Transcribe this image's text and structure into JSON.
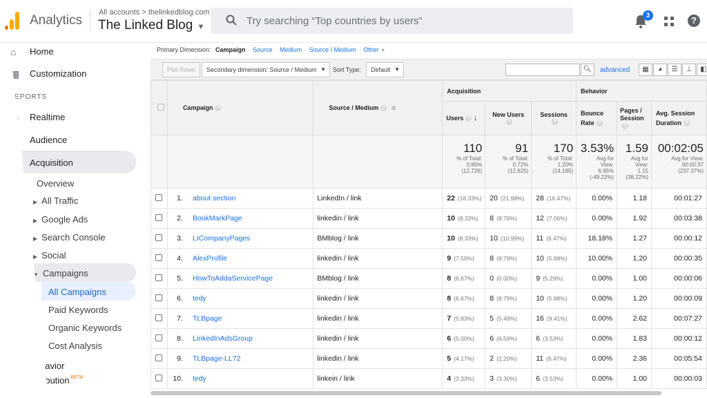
{
  "header": {
    "brand": "Analytics",
    "account_path": "All accounts > thelinkedblog.com",
    "account_name": "The Linked Blog",
    "search_placeholder": "Try searching “Top countries by users”",
    "notification_count": "3"
  },
  "sidebar": {
    "home": "Home",
    "customization": "Customization",
    "reports_heading": "REPORTS",
    "realtime": "Realtime",
    "audience": "Audience",
    "acquisition": "Acquisition",
    "overview": "Overview",
    "all_traffic": "All Traffic",
    "google_ads": "Google Ads",
    "search_console": "Search Console",
    "social": "Social",
    "campaigns": "Campaigns",
    "all_campaigns": "All Campaigns",
    "paid_keywords": "Paid Keywords",
    "organic_keywords": "Organic Keywords",
    "cost_analysis": "Cost Analysis",
    "behavior": "havior",
    "attribution": "ribution",
    "beta": "BETA"
  },
  "primary_dimension": {
    "label": "Primary Dimension:",
    "selected": "Campaign",
    "options": [
      "Source",
      "Medium",
      "Source / Medium",
      "Other"
    ]
  },
  "toolbar": {
    "plot_rows": "Plot Rows",
    "secondary_dimension": "Secondary dimension: Source / Medium",
    "sort_type_label": "Sort Type:",
    "sort_type_value": "Default",
    "advanced": "advanced"
  },
  "table": {
    "group_acquisition": "Acquisition",
    "group_behavior": "Behavior",
    "col_campaign": "Campaign",
    "col_source_medium": "Source / Medium",
    "col_users": "Users",
    "col_new_users": "New Users",
    "col_sessions": "Sessions",
    "col_bounce_rate": "Bounce Rate",
    "col_pages_session": "Pages / Session",
    "col_avg_duration": "Avg. Session Duration",
    "totals": {
      "users": {
        "value": "110",
        "l1": "% of Total:",
        "l2": "0.86%",
        "l3": "(12,726)"
      },
      "new_users": {
        "value": "91",
        "l1": "% of Total:",
        "l2": "0.72%",
        "l3": "(12,625)"
      },
      "sessions": {
        "value": "170",
        "l1": "% of Total:",
        "l2": "1.20%",
        "l3": "(14,185)"
      },
      "bounce": {
        "value": "3.53%",
        "l1": "Avg for",
        "l2": "View:",
        "l3": "6.95%",
        "l4": "(-49.22%)"
      },
      "pages": {
        "value": "1.59",
        "l1": "Avg for",
        "l2": "View:",
        "l3": "1.15",
        "l4": "(38.22%)"
      },
      "duration": {
        "value": "00:02:05",
        "l1": "Avg for View:",
        "l2": "00:00:37",
        "l3": "(237.37%)"
      }
    },
    "rows": [
      {
        "n": "1.",
        "campaign": "about section",
        "sm": "LinkedIn / link",
        "users": "22",
        "users_pct": "(18.33%)",
        "new": "20",
        "new_pct": "(21.98%)",
        "sess": "28",
        "sess_pct": "(16.47%)",
        "bounce": "0.00%",
        "pages": "1.18",
        "dur": "00:01:27"
      },
      {
        "n": "2.",
        "campaign": "BookMarkPage",
        "sm": "linkedin / link",
        "users": "10",
        "users_pct": "(8.33%)",
        "new": "8",
        "new_pct": "(8.79%)",
        "sess": "12",
        "sess_pct": "(7.06%)",
        "bounce": "0.00%",
        "pages": "1.92",
        "dur": "00:03:38"
      },
      {
        "n": "3.",
        "campaign": "LICompanyPages",
        "sm": "BMblog / link",
        "users": "10",
        "users_pct": "(8.33%)",
        "new": "10",
        "new_pct": "(10.99%)",
        "sess": "11",
        "sess_pct": "(6.47%)",
        "bounce": "18.18%",
        "pages": "1.27",
        "dur": "00:00:12"
      },
      {
        "n": "4.",
        "campaign": "AlexProfile",
        "sm": "linkedin / link",
        "users": "9",
        "users_pct": "(7.50%)",
        "new": "8",
        "new_pct": "(8.79%)",
        "sess": "10",
        "sess_pct": "(5.88%)",
        "bounce": "10.00%",
        "pages": "1.20",
        "dur": "00:00:35"
      },
      {
        "n": "5.",
        "campaign": "HowToAddaServicePage",
        "sm": "BMblog / link",
        "users": "8",
        "users_pct": "(6.67%)",
        "new": "0",
        "new_pct": "(0.00%)",
        "sess": "9",
        "sess_pct": "(5.29%)",
        "bounce": "0.00%",
        "pages": "1.00",
        "dur": "00:00:06"
      },
      {
        "n": "6.",
        "campaign": "tedy",
        "sm": "linkedin / link",
        "users": "8",
        "users_pct": "(6.67%)",
        "new": "8",
        "new_pct": "(8.79%)",
        "sess": "10",
        "sess_pct": "(5.88%)",
        "bounce": "0.00%",
        "pages": "1.20",
        "dur": "00:00:09"
      },
      {
        "n": "7.",
        "campaign": "TLBpage",
        "sm": "linkedin / link",
        "users": "7",
        "users_pct": "(5.83%)",
        "new": "5",
        "new_pct": "(5.49%)",
        "sess": "16",
        "sess_pct": "(9.41%)",
        "bounce": "0.00%",
        "pages": "2.62",
        "dur": "00:07:27"
      },
      {
        "n": "8.",
        "campaign": "LinkedInAdsGroup",
        "sm": "linkedin / link",
        "users": "6",
        "users_pct": "(5.00%)",
        "new": "6",
        "new_pct": "(6.59%)",
        "sess": "6",
        "sess_pct": "(3.53%)",
        "bounce": "0.00%",
        "pages": "1.83",
        "dur": "00:00:12"
      },
      {
        "n": "9.",
        "campaign": "TLBpage-LL72",
        "sm": "linkedin / link",
        "users": "5",
        "users_pct": "(4.17%)",
        "new": "2",
        "new_pct": "(2.20%)",
        "sess": "11",
        "sess_pct": "(6.47%)",
        "bounce": "0.00%",
        "pages": "2.36",
        "dur": "00:05:54"
      },
      {
        "n": "10.",
        "campaign": "tedy",
        "sm": "linkein / link",
        "users": "4",
        "users_pct": "(3.33%)",
        "new": "3",
        "new_pct": "(3.30%)",
        "sess": "6",
        "sess_pct": "(3.53%)",
        "bounce": "0.00%",
        "pages": "1.00",
        "dur": "00:00:03"
      }
    ]
  }
}
